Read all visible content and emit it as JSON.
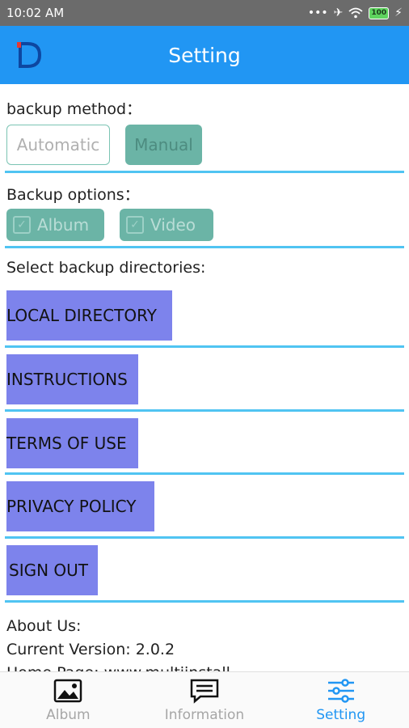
{
  "status_bar": {
    "time": "10:02 AM",
    "battery": "100",
    "icons": [
      "signal-dots-icon",
      "airplane-icon",
      "wifi-icon",
      "battery-icon",
      "charging-icon"
    ]
  },
  "app_bar": {
    "title": "Setting",
    "logo_icon": "app-logo-icon"
  },
  "backup_method": {
    "label": "backup method：",
    "options": [
      "Automatic",
      "Manual"
    ],
    "selected": "Manual"
  },
  "backup_options": {
    "label": "Backup options：",
    "items": [
      {
        "label": "Album",
        "checked": true
      },
      {
        "label": "Video",
        "checked": true
      }
    ]
  },
  "directories": {
    "label": "Select backup directories:"
  },
  "menu": {
    "local_directory": "LOCAL DIRECTORY",
    "instructions": "INSTRUCTIONS",
    "terms": "TERMS OF USE",
    "privacy": "PRIVACY POLICY",
    "sign_out": "SIGN OUT"
  },
  "about": {
    "heading": "About Us:",
    "version": "Current Version: 2.0.2",
    "partial": "Home Page: www.multiinstall"
  },
  "bottom_nav": {
    "tabs": [
      {
        "label": "Album",
        "icon": "image-icon",
        "active": false
      },
      {
        "label": "Information",
        "icon": "message-icon",
        "active": false
      },
      {
        "label": "Setting",
        "icon": "sliders-icon",
        "active": true
      }
    ]
  },
  "colors": {
    "primary": "#2196f3",
    "divider": "#50c4f2",
    "teal": "#6bb4a6",
    "menu_button": "#7d83ec"
  }
}
